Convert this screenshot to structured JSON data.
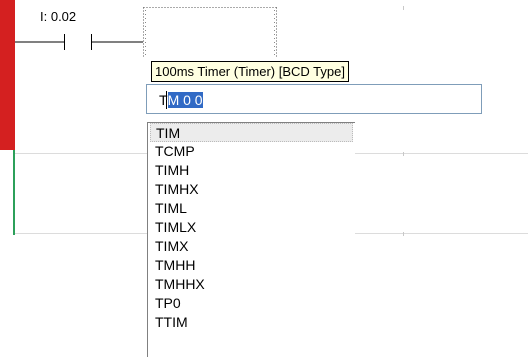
{
  "ladder": {
    "contact_address": "I: 0.02"
  },
  "tooltip": {
    "text": "100ms Timer (Timer) [BCD Type]"
  },
  "edit_field": {
    "prefix": "T",
    "selected_text": "M 0 0"
  },
  "suggestions": {
    "items": [
      "TIM",
      "TCMP",
      "TIMH",
      "TIMHX",
      "TIML",
      "TIMLX",
      "TIMX",
      "TMHH",
      "TMHHX",
      "TP0",
      "TTIM"
    ],
    "selected_index": 0
  },
  "colors": {
    "power_rail_active": "#d42020",
    "power_rail_inactive": "#2ca05a",
    "tooltip_bg": "#ffffe1",
    "selection": "#316ac5",
    "list_highlight": "#ececec"
  },
  "icons": {
    "contact": "normally-open-contact-icon"
  }
}
